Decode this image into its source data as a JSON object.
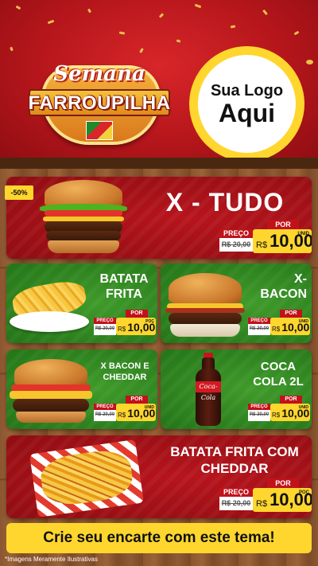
{
  "header": {
    "event_title_line1": "Semana",
    "event_title_line2": "FARROUPILHA",
    "logo_placeholder_line1": "Sua Logo",
    "logo_placeholder_line2": "Aqui"
  },
  "discount_badge": "-50%",
  "products": [
    {
      "name": "X - TUDO",
      "old_label": "PREÇO",
      "old_price": "R$ 20,00",
      "por_label": "POR",
      "currency": "R$",
      "price": "10,00",
      "unit": "UNID"
    },
    {
      "name_line1": "BATATA",
      "name_line2": "FRITA",
      "old_label": "PREÇO",
      "old_price": "R$ 20,00",
      "por_label": "POR",
      "currency": "R$",
      "price": "10,00",
      "unit": "POÇ"
    },
    {
      "name_line1": "X-",
      "name_line2": "BACON",
      "old_label": "PREÇO",
      "old_price": "R$ 20,00",
      "por_label": "POR",
      "currency": "R$",
      "price": "10,00",
      "unit": "UNID"
    },
    {
      "name_line1": "X BACON E",
      "name_line2": "CHEDDAR",
      "old_label": "PREÇO",
      "old_price": "R$ 20,00",
      "por_label": "POR",
      "currency": "R$",
      "price": "10,00",
      "unit": "UNID"
    },
    {
      "name_line1": "COCA",
      "name_line2": "COLA 2L",
      "old_label": "PREÇO",
      "old_price": "R$ 20,00",
      "por_label": "POR",
      "currency": "R$",
      "price": "10,00",
      "unit": "UNID"
    },
    {
      "name_line1": "BATATA FRITA COM",
      "name_line2": "CHEDDAR",
      "old_label": "PREÇO",
      "old_price": "R$ 20,00",
      "por_label": "POR",
      "currency": "R$",
      "price": "10,00",
      "unit": "POÇ"
    }
  ],
  "bottle_label": "Coca-Cola",
  "cta": "Crie seu encarte com este tema!",
  "footnote": "*Imagens Meramente Ilustrativas",
  "colors": {
    "red": "#b8141c",
    "green": "#3f9b2a",
    "yellow": "#ffd62e",
    "wood": "#8b5630"
  }
}
